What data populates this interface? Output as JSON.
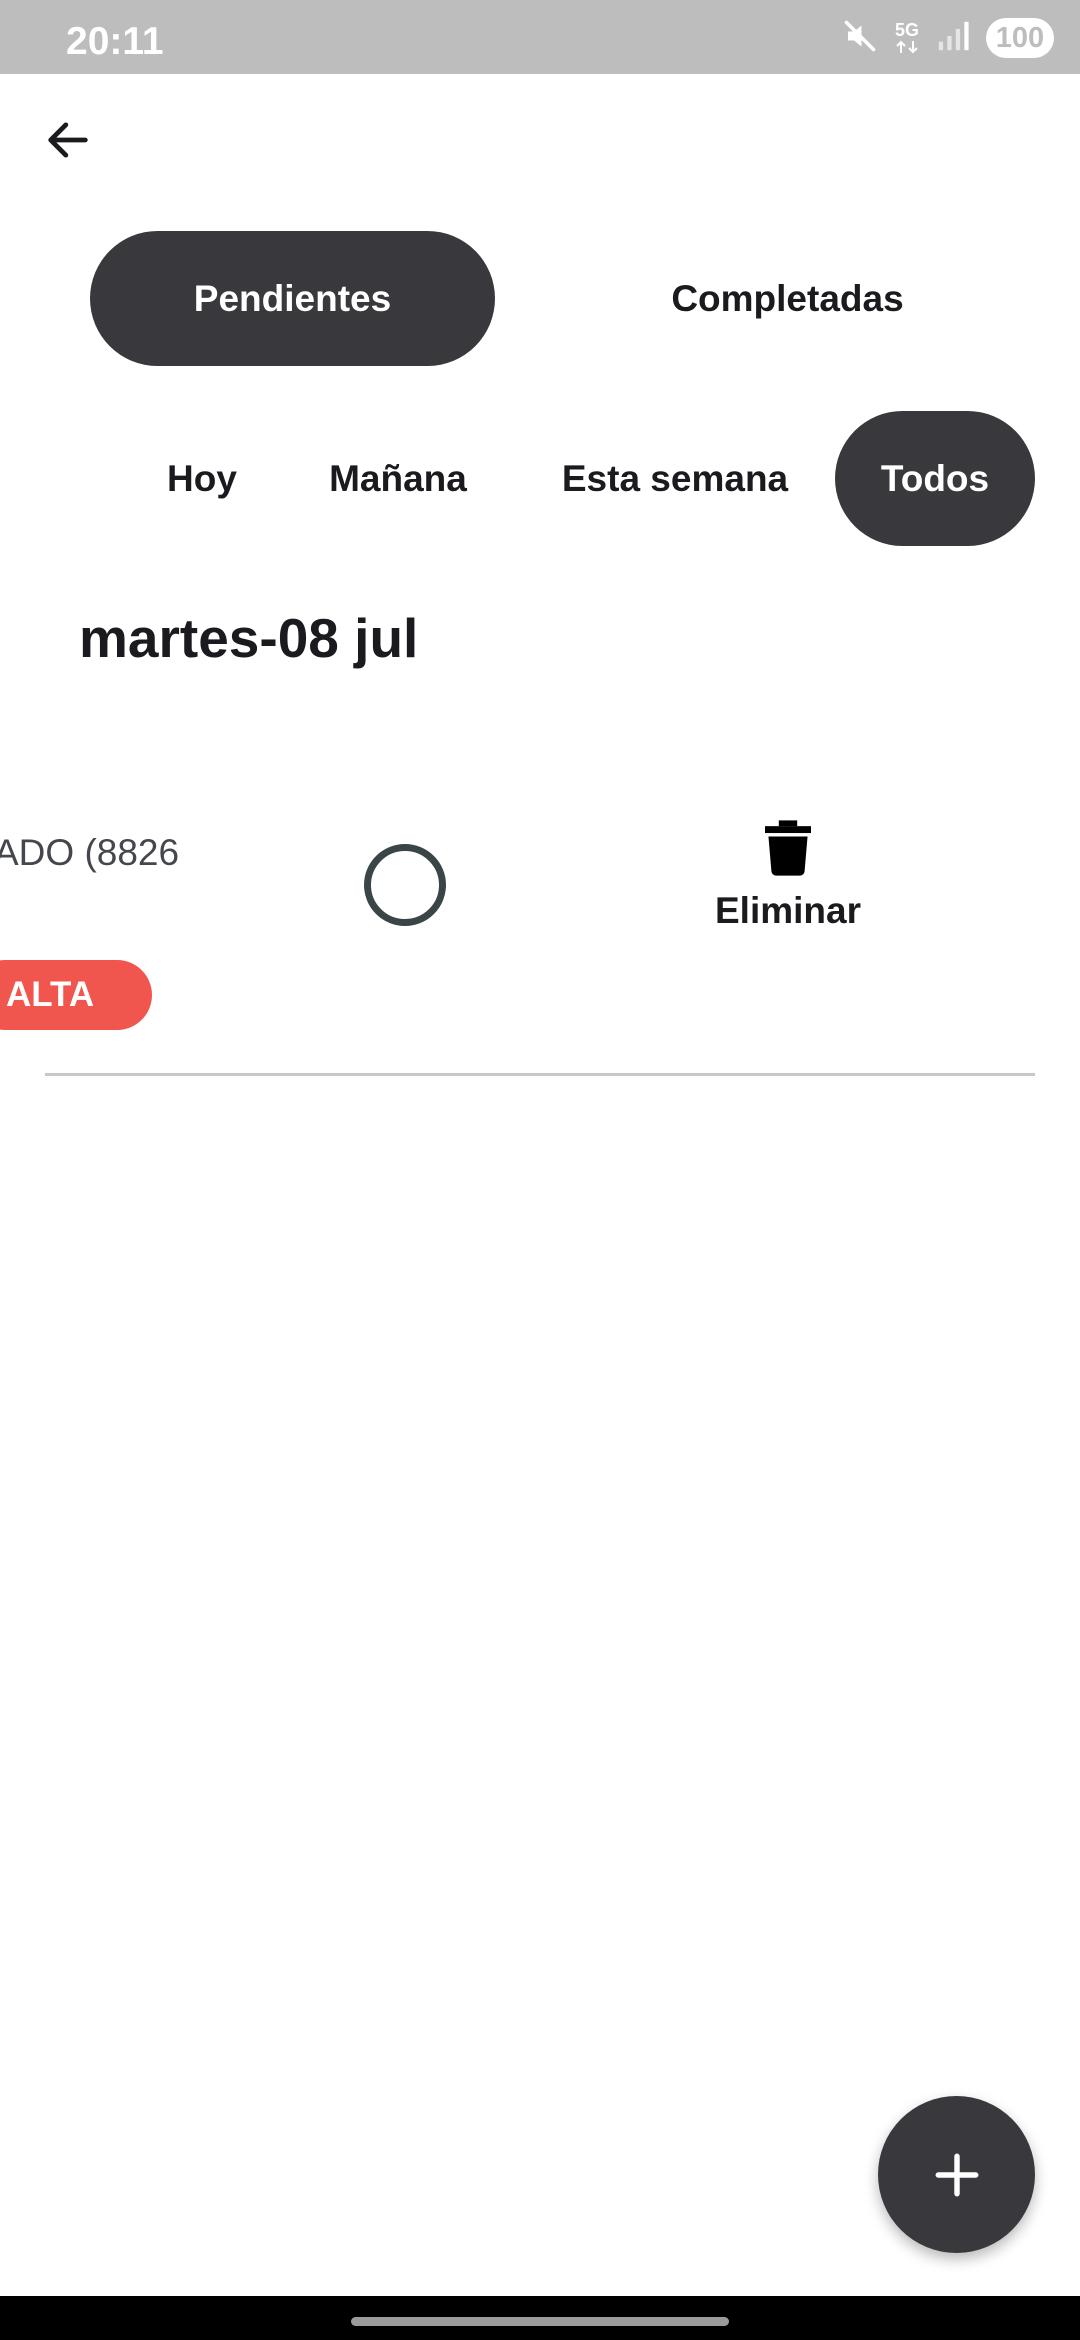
{
  "status_bar": {
    "time": "20:11",
    "network": "5G",
    "battery": "100",
    "icons": [
      "mute-icon",
      "network-5g-icon",
      "signal-icon",
      "battery-icon"
    ]
  },
  "header": {
    "back_icon": "arrow-left-icon"
  },
  "tabs": [
    {
      "label": "Pendientes",
      "active": true
    },
    {
      "label": "Completadas",
      "active": false
    }
  ],
  "filters": [
    {
      "label": "Hoy",
      "active": false
    },
    {
      "label": "Mañana",
      "active": false
    },
    {
      "label": "Esta semana",
      "active": false
    },
    {
      "label": "Todos",
      "active": true
    }
  ],
  "date_group": {
    "heading": "martes-08 jul"
  },
  "task": {
    "title": "ADO (8826",
    "priority": "ALTA",
    "delete_label": "Eliminar",
    "delete_icon": "trash-icon",
    "complete_icon": "circle-outline-icon"
  },
  "fab": {
    "icon": "plus-icon"
  },
  "colors": {
    "primary_dark": "#38383d",
    "priority_high": "#f1564e",
    "status_bar": "#bdbdbd",
    "text": "#1b1b1f"
  }
}
